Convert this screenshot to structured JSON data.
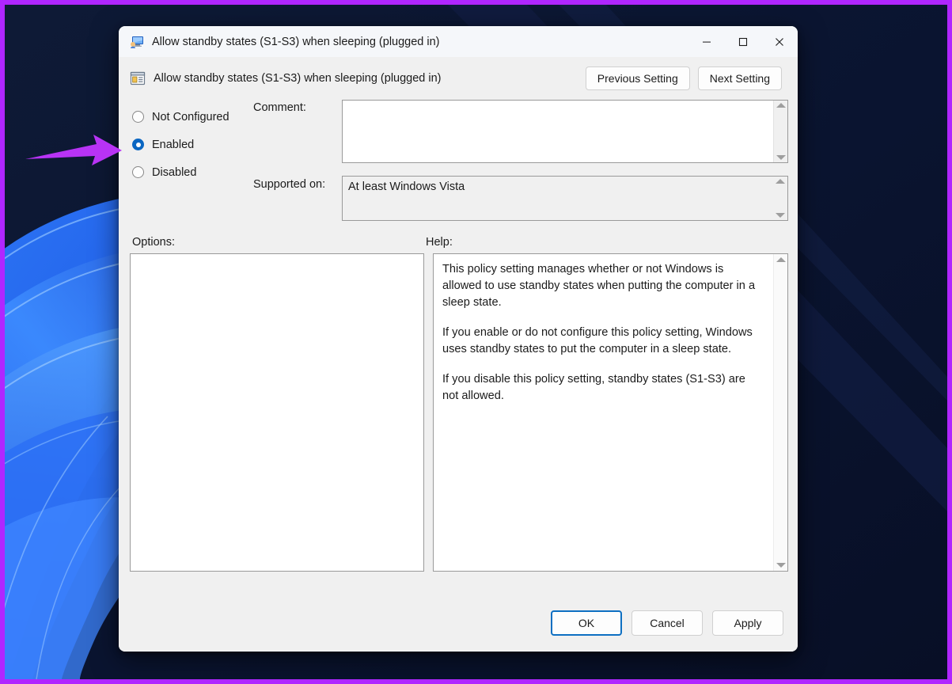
{
  "window": {
    "title": "Allow standby states (S1-S3) when sleeping (plugged in)",
    "icon": "policy-monitor-icon",
    "minimize_label": "—",
    "maximize_label": "☐",
    "close_label": "✕"
  },
  "header": {
    "policy_title": "Allow standby states (S1-S3) when sleeping (plugged in)",
    "icon": "group-policy-setting-icon",
    "previous_setting_label": "Previous Setting",
    "next_setting_label": "Next Setting"
  },
  "states": {
    "options": [
      {
        "label": "Not Configured",
        "selected": false
      },
      {
        "label": "Enabled",
        "selected": true
      },
      {
        "label": "Disabled",
        "selected": false
      }
    ]
  },
  "comment": {
    "label": "Comment:",
    "value": "",
    "scroll_up_icon": "triangle-up-icon",
    "scroll_down_icon": "triangle-down-icon"
  },
  "supported_on": {
    "label": "Supported on:",
    "value": "At least Windows Vista",
    "scroll_up_icon": "triangle-up-icon",
    "scroll_down_icon": "triangle-down-icon"
  },
  "panels": {
    "options_label": "Options:",
    "options_value": "",
    "help_label": "Help:",
    "help_paragraphs": [
      "This policy setting manages whether or not Windows is allowed to use standby states when putting the computer in a sleep state.",
      "If you enable or do not configure this policy setting, Windows uses standby states to put the computer in a sleep state.",
      "If you disable this policy setting, standby states (S1-S3) are not allowed."
    ],
    "help_scroll_up_icon": "triangle-up-icon",
    "help_scroll_down_icon": "triangle-down-icon"
  },
  "footer": {
    "ok_label": "OK",
    "cancel_label": "Cancel",
    "apply_label": "Apply"
  },
  "annotation": {
    "arrow_color": "#b833f5",
    "frame_color": "#b026ff",
    "arrow_name": "pointer-arrow-to-enabled-radio"
  },
  "colors": {
    "accent": "#0a66c2",
    "default_button_border": "#0d6fc2",
    "dialog_background": "#f0f0f0",
    "titlebar_background": "#f5f7fa",
    "desktop_background": "#0c1730"
  }
}
